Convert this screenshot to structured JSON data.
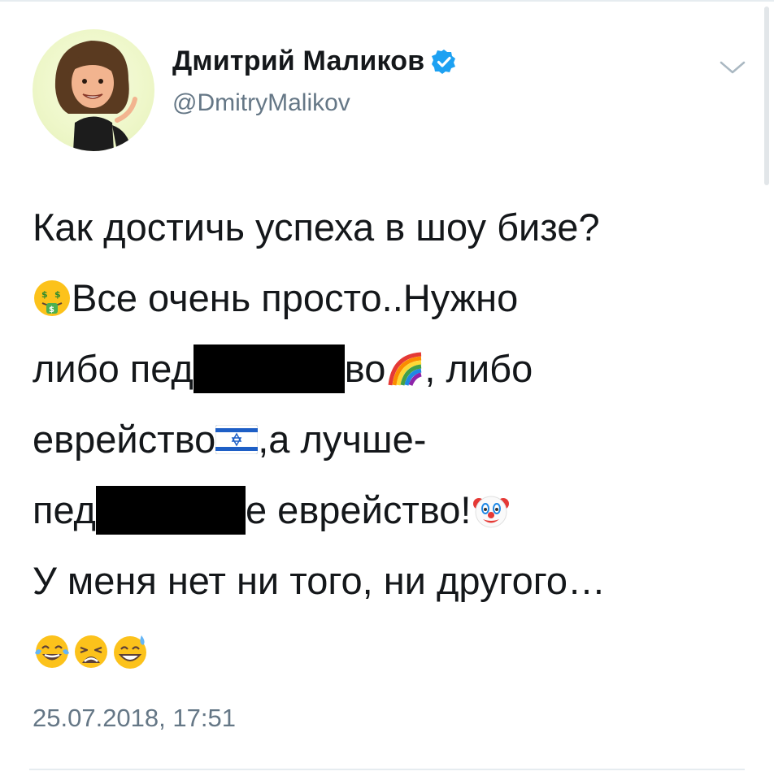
{
  "tweet": {
    "author": {
      "display_name": "Дмитрий Маликов",
      "handle": "@DmitryMalikov",
      "verified": true,
      "verified_color": "#1da1f2"
    },
    "lines": {
      "l1": "Как достичь успеха в шоу бизе?",
      "l2": "Все очень просто..Нужно",
      "l3a": "либо пед",
      "l3b": "во",
      "l3c": ", либо",
      "l4a": "еврейство",
      "l4b": ",а лучше-",
      "l5a": "пед",
      "l5b": "е еврейство!",
      "l6": "У меня нет ни того, ни другого…"
    },
    "emojis": [
      "money-mouth-face",
      "rainbow",
      "israel-flag",
      "clown-face",
      "face-with-tears-of-joy",
      "weary-face",
      "grinning-face-with-sweat"
    ],
    "redacted": true,
    "timestamp": "25.07.2018, 17:51"
  },
  "colors": {
    "text": "#14171a",
    "secondary": "#657786",
    "divider": "#e6ecf0",
    "accent": "#1da1f2"
  }
}
